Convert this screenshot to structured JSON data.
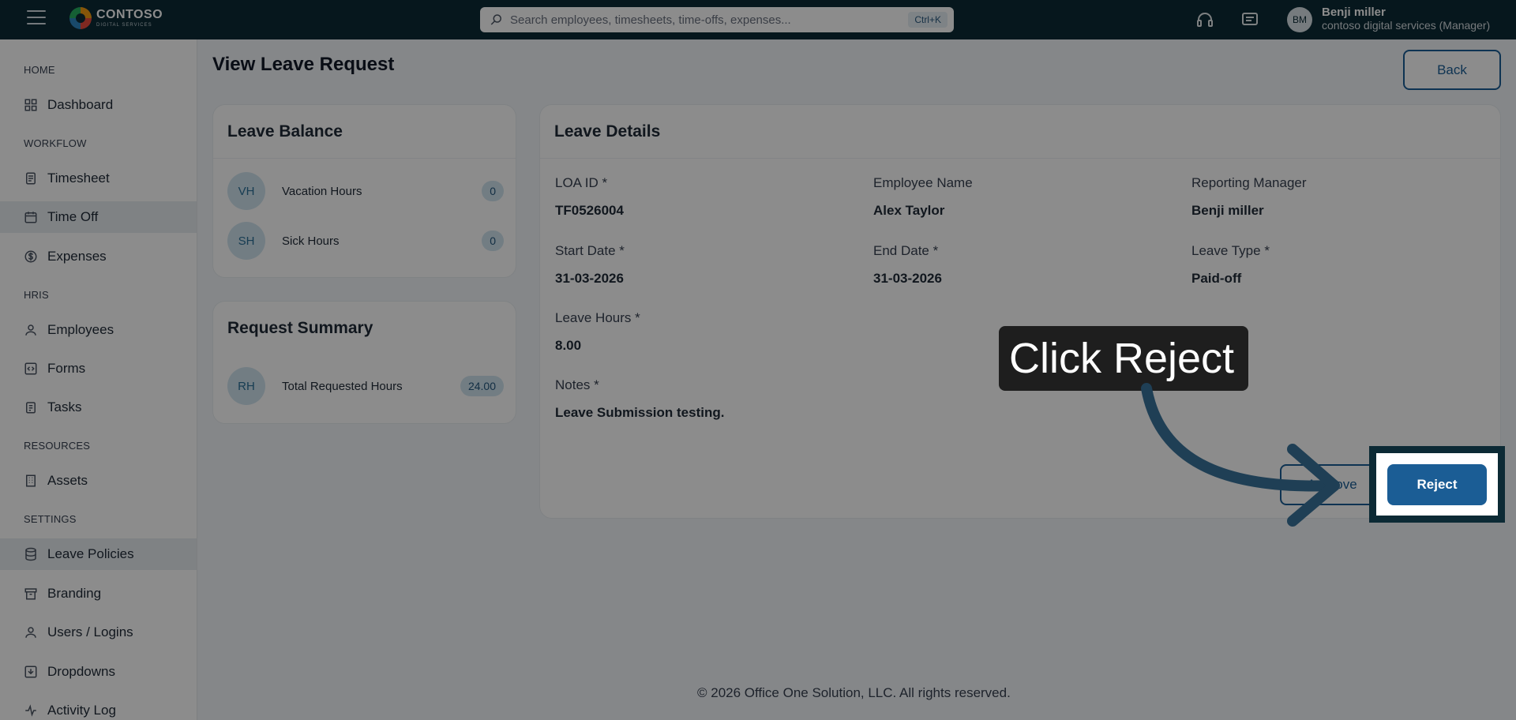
{
  "topbar": {
    "logo_name": "CONTOSO",
    "logo_sub": "DIGITAL SERVICES",
    "search_placeholder": "Search employees, timesheets, time-offs, expenses...",
    "search_shortcut": "Ctrl+K",
    "user_initials": "BM",
    "user_name": "Benji miller",
    "user_role": "contoso digital services (Manager)"
  },
  "sidebar": {
    "sections": {
      "home": "HOME",
      "workflow": "WORKFLOW",
      "hris": "HRIS",
      "resources": "RESOURCES",
      "settings": "SETTINGS"
    },
    "items": {
      "dashboard": "Dashboard",
      "timesheet": "Timesheet",
      "time_off": "Time Off",
      "expenses": "Expenses",
      "employees": "Employees",
      "forms": "Forms",
      "tasks": "Tasks",
      "assets": "Assets",
      "leave_policies": "Leave Policies",
      "branding": "Branding",
      "users_logins": "Users / Logins",
      "dropdowns": "Dropdowns",
      "activity_log": "Activity Log"
    }
  },
  "page": {
    "title": "View Leave Request",
    "back_label": "Back"
  },
  "balance": {
    "title": "Leave Balance",
    "rows": [
      {
        "initials": "VH",
        "label": "Vacation Hours",
        "value": "0"
      },
      {
        "initials": "SH",
        "label": "Sick Hours",
        "value": "0"
      }
    ]
  },
  "summary": {
    "title": "Request Summary",
    "rows": [
      {
        "initials": "RH",
        "label": "Total Requested Hours",
        "value": "24.00"
      }
    ]
  },
  "details": {
    "title": "Leave Details",
    "loa_id_label": "LOA ID",
    "loa_id": "TF0526004",
    "employee_name_label": "Employee Name",
    "employee_name": "Alex Taylor",
    "reporting_manager_label": "Reporting Manager",
    "reporting_manager": "Benji miller",
    "start_date_label": "Start Date",
    "start_date": "31-03-2026",
    "end_date_label": "End Date",
    "end_date": "31-03-2026",
    "leave_type_label": "Leave Type",
    "leave_type": "Paid-off",
    "leave_hours_label": "Leave Hours",
    "leave_hours": "8.00",
    "notes_label": "Notes",
    "notes": "Leave Submission testing.",
    "required_mark": "*",
    "approve_label": "Approve",
    "reject_label": "Reject"
  },
  "footer": {
    "text": "© 2026 Office One Solution, LLC. All rights reserved."
  },
  "tutorial": {
    "callout_text": "Click Reject"
  }
}
